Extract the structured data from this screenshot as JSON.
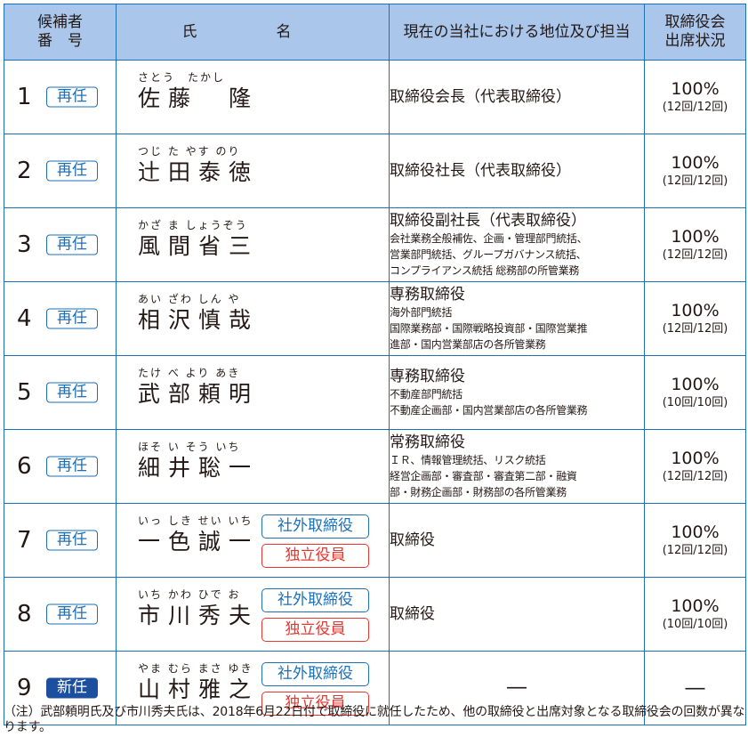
{
  "headers": {
    "no_line1": "候補者",
    "no_line2": "番　号",
    "name": "氏　名",
    "position": "現在の当社における地位及び担当",
    "att_line1": "取締役会",
    "att_line2": "出席状況"
  },
  "colors": {
    "accent": "#1d6fb8",
    "header_bg": "#aac6ea",
    "independent": "#e8352e",
    "new_badge": "#1d4fa0"
  },
  "rows": [
    {
      "no": "1",
      "status": "再任",
      "ruby": "さとう　たかし",
      "name": "佐藤　隆",
      "pos_main": "取締役会長（代表取締役）",
      "pos_sub": [
        "",
        "",
        ""
      ],
      "pct": "100%",
      "count": "(12回/12回)"
    },
    {
      "no": "2",
      "status": "再任",
      "ruby": "つじ た やす のり",
      "name": "辻田泰徳",
      "pos_main": "取締役社長（代表取締役）",
      "pos_sub": [
        "",
        "",
        ""
      ],
      "pct": "100%",
      "count": "(12回/12回)"
    },
    {
      "no": "3",
      "status": "再任",
      "ruby": "かざ ま しょうぞう",
      "name": "風間省三",
      "pos_main": "取締役副社長（代表取締役）",
      "pos_sub": [
        "会社業務全般補佐、企画・管理部門統括、",
        "営業部門統括、グループガバナンス統括、",
        "コンプライアンス統括 総務部の所管業務"
      ],
      "pct": "100%",
      "count": "(12回/12回)"
    },
    {
      "no": "4",
      "status": "再任",
      "ruby": "あい ざわ しん や",
      "name": "相沢慎哉",
      "pos_main": "専務取締役",
      "pos_sub": [
        "海外部門統括",
        "国際業務部・国際戦略投資部・国際営業推",
        "進部・国内営業部店の各所管業務"
      ],
      "pct": "100%",
      "count": "(12回/12回)"
    },
    {
      "no": "5",
      "status": "再任",
      "ruby": "たけ べ より あき",
      "name": "武部頼明",
      "pos_main": "専務取締役",
      "pos_sub": [
        "不動産部門統括",
        "不動産企画部・国内営業部店の各所管業務",
        ""
      ],
      "pct": "100%",
      "count": "(10回/10回)"
    },
    {
      "no": "6",
      "status": "再任",
      "ruby": "ほそ い そう いち",
      "name": "細井聡一",
      "pos_main": "常務取締役",
      "pos_sub": [
        "ＩＲ、情報管理統括、リスク統括",
        "経営企画部・審査部・審査第二部・融資",
        "部・財務企画部・財務部の各所管業務"
      ],
      "pct": "100%",
      "count": "(12回/12回)"
    },
    {
      "no": "7",
      "status": "再任",
      "ruby": "いっ しき せい いち",
      "name": "一色誠一",
      "tag_outside": "社外取締役",
      "tag_indep": "独立役員",
      "pos_main": "取締役",
      "pos_sub": [
        "",
        "",
        ""
      ],
      "pct": "100%",
      "count": "(12回/12回)"
    },
    {
      "no": "8",
      "status": "再任",
      "ruby": "いち かわ ひで お",
      "name": "市川秀夫",
      "tag_outside": "社外取締役",
      "tag_indep": "独立役員",
      "pos_main": "取締役",
      "pos_sub": [
        "",
        "",
        ""
      ],
      "pct": "100%",
      "count": "(10回/10回)"
    },
    {
      "no": "9",
      "status": "新任",
      "ruby": "やま むら まさ ゆき",
      "name": "山村雅之",
      "tag_outside": "社外取締役",
      "tag_indep": "独立役員",
      "pos_main": "―",
      "pos_sub": [
        "",
        "",
        ""
      ],
      "pct": "―",
      "count": ""
    }
  ],
  "note": "（注）武部頼明氏及び市川秀夫氏は、2018年6月22日付で取締役に就任したため、他の取締役と出席対象となる取締役会の回数が異なります。"
}
